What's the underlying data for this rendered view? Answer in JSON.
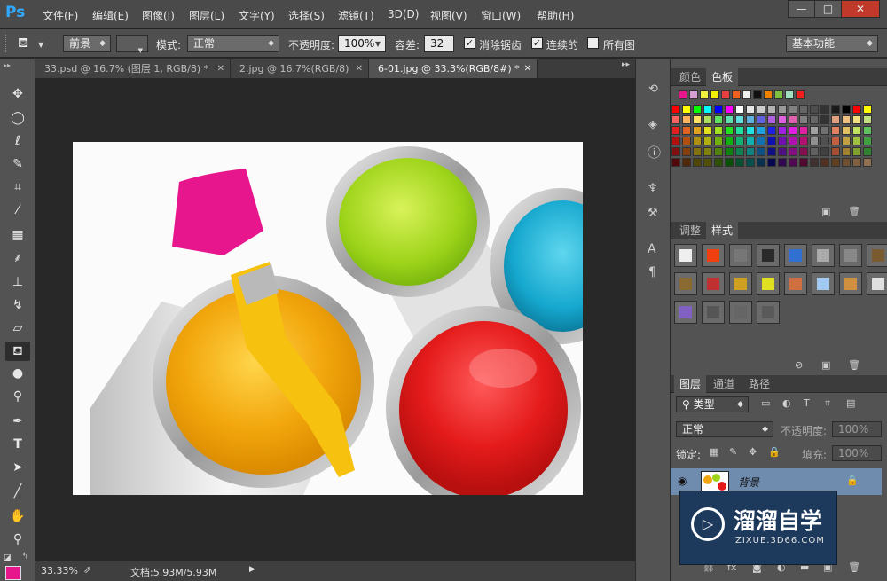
{
  "app": {
    "logo": "Ps"
  },
  "menu": [
    "文件(F)",
    "编辑(E)",
    "图像(I)",
    "图层(L)",
    "文字(Y)",
    "选择(S)",
    "滤镜(T)",
    "3D(D)",
    "视图(V)",
    "窗口(W)",
    "帮助(H)"
  ],
  "window": {
    "minimize": "—",
    "maximize": "□",
    "close": "✕"
  },
  "options": {
    "fill_source": "前景",
    "mode_label": "模式:",
    "mode_value": "正常",
    "opacity_label": "不透明度:",
    "opacity_value": "100%",
    "tolerance_label": "容差:",
    "tolerance_value": "32",
    "antialias_label": "消除锯齿",
    "contiguous_label": "连续的",
    "all_layers_label": "所有图",
    "workspace": "基本功能"
  },
  "tabs": [
    {
      "label": "33.psd @ 16.7% (图层 1, RGB/8) *",
      "close": "✕"
    },
    {
      "label": "2.jpg @ 16.7%(RGB/8)",
      "close": "✕"
    },
    {
      "label": "6-01.jpg @ 33.3%(RGB/8#) *",
      "close": "✕"
    }
  ],
  "status": {
    "zoom": "33.33%",
    "doc_info": "文档:5.93M/5.93M"
  },
  "panels": {
    "color_tab": "颜色",
    "swatches_tab": "色板",
    "adjust_tab": "调整",
    "styles_tab": "样式",
    "layers_tab": "图层",
    "channels_tab": "通道",
    "paths_tab": "路径",
    "filter_kind": "类型",
    "blend_mode": "正常",
    "opacity_label": "不透明度:",
    "opacity_value": "100%",
    "lock_label": "锁定:",
    "fill_label": "填充:",
    "fill_value": "100%",
    "layer_name": "背景"
  },
  "watermark": {
    "title": "溜溜自学",
    "url": "ZIXUE.3D66.COM"
  },
  "colors": {
    "accent": "#31a8ff",
    "foreground": "#e8168c",
    "background": "#ffffff",
    "layer_selected": "#6f8bad"
  }
}
